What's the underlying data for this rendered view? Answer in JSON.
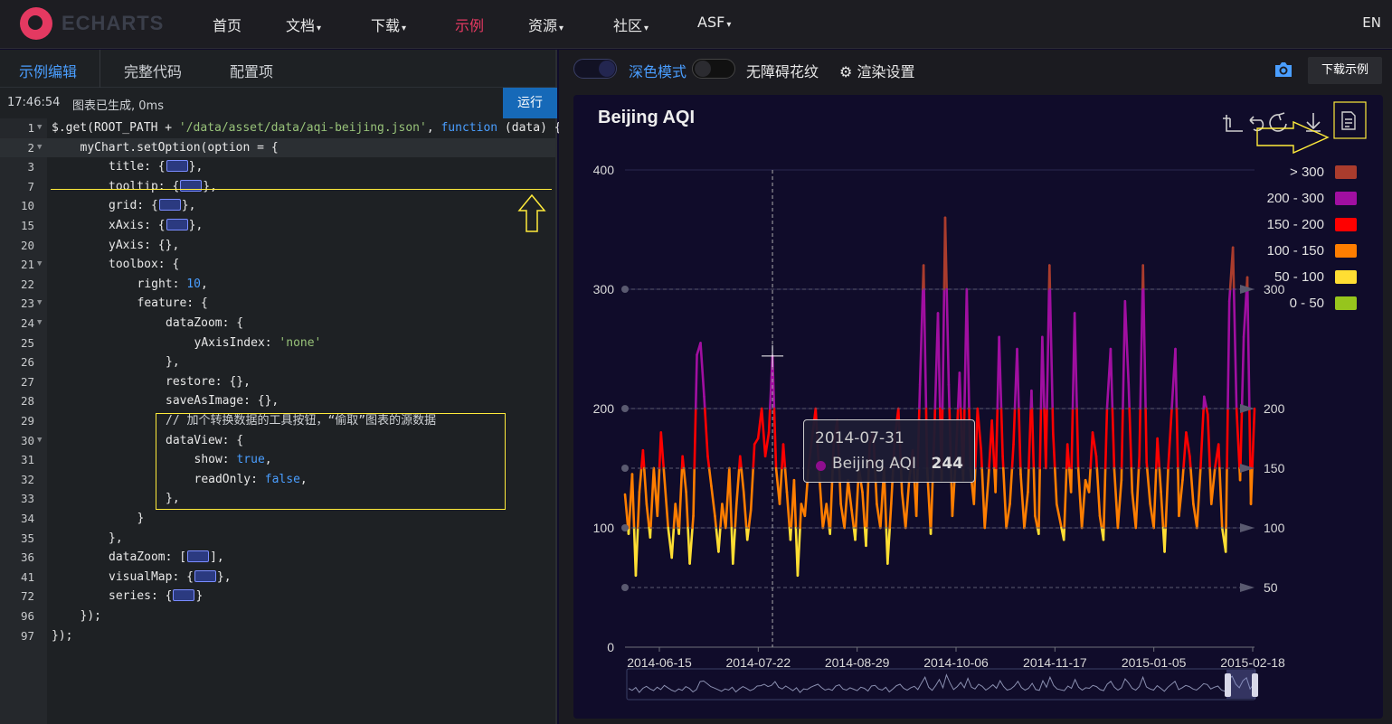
{
  "nav": {
    "logo_text": "ECHARTS",
    "items": [
      {
        "label": "首页",
        "caret": false,
        "active": false
      },
      {
        "label": "文档",
        "caret": true,
        "active": false
      },
      {
        "label": "下载",
        "caret": true,
        "active": false
      },
      {
        "label": "示例",
        "caret": false,
        "active": true
      },
      {
        "label": "资源",
        "caret": true,
        "active": false
      },
      {
        "label": "社区",
        "caret": true,
        "active": false
      },
      {
        "label": "ASF",
        "caret": true,
        "active": false
      }
    ],
    "lang": "EN"
  },
  "editor_panel": {
    "tabs": [
      "示例编辑",
      "完整代码",
      "配置项"
    ],
    "status_time": "17:46:54",
    "status_msg": "图表已生成, 0ms",
    "run_label": "运行"
  },
  "code_lines": [
    {
      "n": "1",
      "fold": true,
      "indent": 0,
      "parts": [
        [
          "$.get(ROOT_PATH + ",
          ""
        ],
        [
          "'/data/asset/data/aqi-beijing.json'",
          "s"
        ],
        [
          ", ",
          ""
        ],
        [
          "function",
          "k"
        ],
        [
          " (data) {",
          ""
        ]
      ]
    },
    {
      "n": "2",
      "fold": true,
      "indent": 1,
      "active": true,
      "parts": [
        [
          "myChart.setOption(option = {",
          ""
        ]
      ]
    },
    {
      "n": "3",
      "fold": false,
      "indent": 2,
      "parts": [
        [
          "title: {",
          ""
        ],
        [
          "",
          "fb"
        ],
        [
          "},",
          ""
        ]
      ]
    },
    {
      "n": "7",
      "fold": false,
      "indent": 2,
      "parts": [
        [
          "tooltip: {",
          ""
        ],
        [
          "",
          "fb"
        ],
        [
          "},",
          ""
        ]
      ]
    },
    {
      "n": "10",
      "fold": false,
      "indent": 2,
      "parts": [
        [
          "grid: {",
          ""
        ],
        [
          "",
          "fb"
        ],
        [
          "},",
          ""
        ]
      ]
    },
    {
      "n": "15",
      "fold": false,
      "indent": 2,
      "parts": [
        [
          "xAxis: {",
          ""
        ],
        [
          "",
          "fb"
        ],
        [
          "},",
          ""
        ]
      ]
    },
    {
      "n": "20",
      "fold": false,
      "indent": 2,
      "parts": [
        [
          "yAxis: {},",
          ""
        ]
      ]
    },
    {
      "n": "21",
      "fold": true,
      "indent": 2,
      "parts": [
        [
          "toolbox: {",
          ""
        ]
      ]
    },
    {
      "n": "22",
      "fold": false,
      "indent": 3,
      "parts": [
        [
          "right: ",
          ""
        ],
        [
          "10",
          "n"
        ],
        [
          ",",
          ""
        ]
      ]
    },
    {
      "n": "23",
      "fold": true,
      "indent": 3,
      "parts": [
        [
          "feature: {",
          ""
        ]
      ]
    },
    {
      "n": "24",
      "fold": true,
      "indent": 4,
      "parts": [
        [
          "dataZoom: {",
          ""
        ]
      ]
    },
    {
      "n": "25",
      "fold": false,
      "indent": 5,
      "parts": [
        [
          "yAxisIndex: ",
          ""
        ],
        [
          "'none'",
          "s"
        ]
      ]
    },
    {
      "n": "26",
      "fold": false,
      "indent": 4,
      "parts": [
        [
          "},",
          ""
        ]
      ]
    },
    {
      "n": "27",
      "fold": false,
      "indent": 4,
      "parts": [
        [
          "restore: {},",
          ""
        ]
      ]
    },
    {
      "n": "28",
      "fold": false,
      "indent": 4,
      "parts": [
        [
          "saveAsImage: {},",
          ""
        ]
      ]
    },
    {
      "n": "29",
      "fold": false,
      "indent": 4,
      "parts": [
        [
          "// 加个转换数据的工具按钮，“偷取”图表的源数据",
          "c"
        ]
      ]
    },
    {
      "n": "30",
      "fold": true,
      "indent": 4,
      "parts": [
        [
          "dataView: {",
          ""
        ]
      ]
    },
    {
      "n": "31",
      "fold": false,
      "indent": 5,
      "parts": [
        [
          "show: ",
          ""
        ],
        [
          "true",
          "k"
        ],
        [
          ",",
          ""
        ]
      ]
    },
    {
      "n": "32",
      "fold": false,
      "indent": 5,
      "parts": [
        [
          "readOnly: ",
          ""
        ],
        [
          "false",
          "k"
        ],
        [
          ",",
          ""
        ]
      ]
    },
    {
      "n": "33",
      "fold": false,
      "indent": 4,
      "parts": [
        [
          "},",
          ""
        ]
      ]
    },
    {
      "n": "34",
      "fold": false,
      "indent": 3,
      "parts": [
        [
          "}",
          ""
        ]
      ]
    },
    {
      "n": "35",
      "fold": false,
      "indent": 2,
      "parts": [
        [
          "},",
          ""
        ]
      ]
    },
    {
      "n": "36",
      "fold": false,
      "indent": 2,
      "parts": [
        [
          "dataZoom: [",
          ""
        ],
        [
          "",
          "fb"
        ],
        [
          "],",
          ""
        ]
      ]
    },
    {
      "n": "41",
      "fold": false,
      "indent": 2,
      "parts": [
        [
          "visualMap: {",
          ""
        ],
        [
          "",
          "fb"
        ],
        [
          "},",
          ""
        ]
      ]
    },
    {
      "n": "72",
      "fold": false,
      "indent": 2,
      "parts": [
        [
          "series: {",
          ""
        ],
        [
          "",
          "fb"
        ],
        [
          "}",
          ""
        ]
      ]
    },
    {
      "n": "96",
      "fold": false,
      "indent": 1,
      "parts": [
        [
          "});",
          ""
        ]
      ]
    },
    {
      "n": "97",
      "fold": false,
      "indent": 0,
      "parts": [
        [
          "});",
          ""
        ]
      ]
    }
  ],
  "preview_toolbar": {
    "dark_mode_label": "深色模式",
    "aria_label": "无障碍花纹",
    "render_label": "渲染设置",
    "download_label": "下载示例"
  },
  "tooltip": {
    "date": "2014-07-31",
    "series": "Beijing AQI",
    "value": "244"
  },
  "colors": {
    "accent": "#4a9eff",
    "brand": "#e43961",
    "highlight": "#ffeb3b",
    "chart_bg": "#100c2a"
  },
  "chart_data": {
    "type": "line",
    "title": "Beijing AQI",
    "ylim": [
      0,
      400
    ],
    "y_ticks": [
      0,
      100,
      200,
      300,
      400
    ],
    "x_tick_labels": [
      "2014-06-15",
      "2014-07-22",
      "2014-08-29",
      "2014-10-06",
      "2014-11-17",
      "2015-01-05",
      "2015-02-18"
    ],
    "mark_lines": [
      50,
      100,
      150,
      200,
      300
    ],
    "visual_map": [
      {
        "label": "> 300",
        "color": "#aa3c2d"
      },
      {
        "label": "200 - 300",
        "color": "#a10fa1"
      },
      {
        "label": "150 - 200",
        "color": "#ff0000"
      },
      {
        "label": "100 - 150",
        "color": "#ff7e00"
      },
      {
        "label": "50 - 100",
        "color": "#ffde33"
      },
      {
        "label": "0 - 50",
        "color": "#96c51d"
      }
    ],
    "series": [
      {
        "name": "Beijing AQI",
        "values": [
          128,
          95,
          145,
          60,
          130,
          165,
          120,
          92,
          150,
          110,
          180,
          140,
          100,
          75,
          120,
          95,
          160,
          130,
          70,
          110,
          245,
          255,
          210,
          160,
          135,
          110,
          80,
          120,
          100,
          150,
          70,
          120,
          160,
          130,
          90,
          115,
          170,
          175,
          200,
          160,
          180,
          244,
          150,
          120,
          170,
          130,
          90,
          140,
          60,
          120,
          110,
          150,
          175,
          200,
          145,
          100,
          120,
          95,
          170,
          190,
          120,
          100,
          140,
          115,
          90,
          150,
          130,
          85,
          170,
          180,
          120,
          100,
          150,
          70,
          120,
          175,
          200,
          130,
          100,
          140,
          165,
          110,
          220,
          320,
          150,
          95,
          180,
          280,
          140,
          360,
          220,
          110,
          160,
          230,
          140,
          300,
          150,
          120,
          200,
          165,
          100,
          140,
          190,
          130,
          260,
          160,
          100,
          120,
          170,
          250,
          145,
          100,
          130,
          215,
          110,
          95,
          260,
          150,
          320,
          180,
          120,
          105,
          90,
          170,
          130,
          280,
          150,
          100,
          140,
          130,
          180,
          160,
          110,
          90,
          200,
          250,
          150,
          100,
          140,
          290,
          220,
          130,
          100,
          160,
          320,
          155,
          120,
          100,
          175,
          130,
          80,
          150,
          200,
          250,
          110,
          140,
          180,
          160,
          120,
          100,
          150,
          210,
          195,
          120,
          150,
          170,
          100,
          80,
          290,
          335,
          200,
          140,
          260,
          310,
          120,
          200
        ]
      }
    ]
  }
}
